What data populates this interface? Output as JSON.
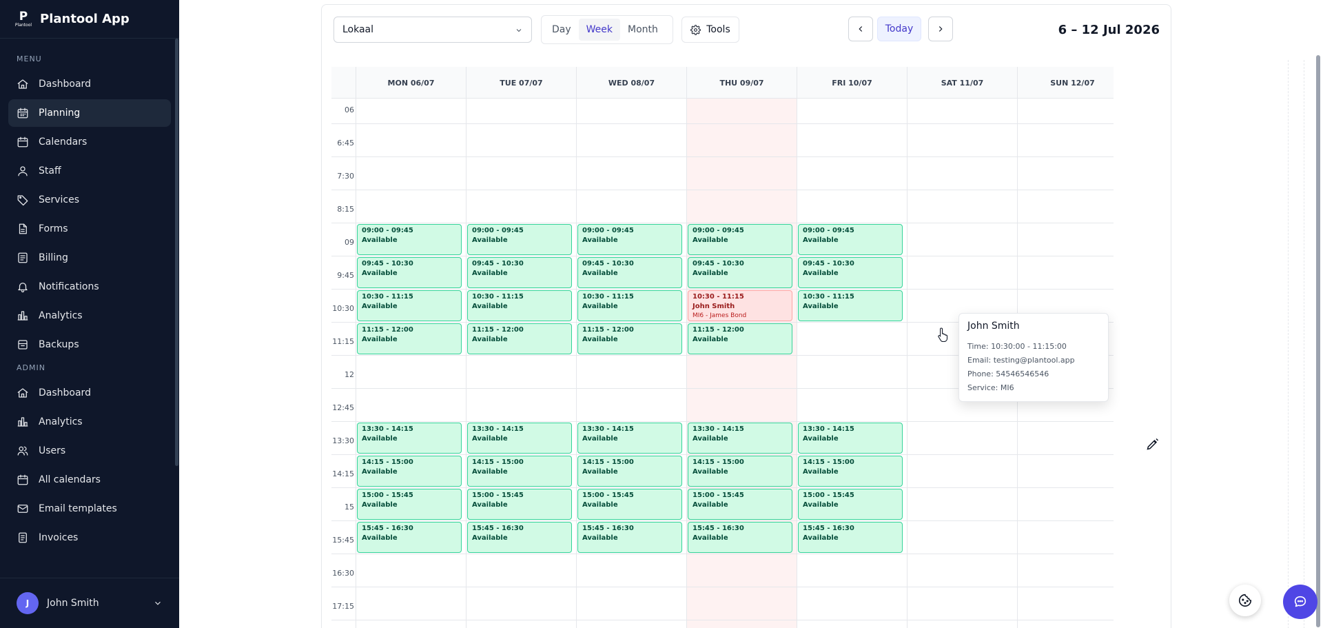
{
  "app": {
    "brand_name": "Plantool App",
    "logo_small": "Plantool",
    "logo_glyph": "P"
  },
  "sidebar": {
    "menu_label": "MENU",
    "menu_items": [
      {
        "label": "Dashboard",
        "icon": "home-icon",
        "active": false
      },
      {
        "label": "Planning",
        "icon": "calendar-grid-icon",
        "active": true
      },
      {
        "label": "Calendars",
        "icon": "calendar-icon",
        "active": false
      },
      {
        "label": "Staff",
        "icon": "user-icon",
        "active": false
      },
      {
        "label": "Services",
        "icon": "tag-icon",
        "active": false
      },
      {
        "label": "Forms",
        "icon": "document-icon",
        "active": false
      },
      {
        "label": "Billing",
        "icon": "credit-card-icon",
        "active": false
      },
      {
        "label": "Notifications",
        "icon": "bell-icon",
        "active": false
      },
      {
        "label": "Analytics",
        "icon": "bar-chart-icon",
        "active": false
      },
      {
        "label": "Backups",
        "icon": "archive-icon",
        "active": false
      }
    ],
    "admin_label": "ADMIN",
    "admin_items": [
      {
        "label": "Dashboard",
        "icon": "home-icon"
      },
      {
        "label": "Analytics",
        "icon": "bar-chart-icon"
      },
      {
        "label": "Users",
        "icon": "users-icon"
      },
      {
        "label": "All calendars",
        "icon": "calendar-icon"
      },
      {
        "label": "Email templates",
        "icon": "mail-icon"
      },
      {
        "label": "Invoices",
        "icon": "receipt-icon"
      }
    ],
    "user": {
      "initial": "J",
      "name": "John Smith"
    }
  },
  "toolbar": {
    "location": "Lokaal",
    "views": [
      {
        "label": "Day",
        "active": false
      },
      {
        "label": "Week",
        "active": true
      },
      {
        "label": "Month",
        "active": false
      }
    ],
    "tools_label": "Tools",
    "today_label": "Today",
    "range_title": "6 – 12 Jul 2026"
  },
  "calendar": {
    "days": [
      "MON 06/07",
      "TUE 07/07",
      "WED 08/07",
      "THU 09/07",
      "FRI 10/07",
      "SAT 11/07",
      "SUN 12/07"
    ],
    "today_index": 3,
    "time_labels": [
      "06",
      "6:45",
      "7:30",
      "8:15",
      "09",
      "9:45",
      "10:30",
      "11:15",
      "12",
      "12:45",
      "13:30",
      "14:15",
      "15",
      "15:45",
      "16:30",
      "17:15"
    ],
    "available_text": "Available",
    "slots": [
      {
        "day": 0,
        "row": 4,
        "time": "09:00 - 09:45",
        "status": "Available"
      },
      {
        "day": 1,
        "row": 4,
        "time": "09:00 - 09:45",
        "status": "Available"
      },
      {
        "day": 2,
        "row": 4,
        "time": "09:00 - 09:45",
        "status": "Available"
      },
      {
        "day": 3,
        "row": 4,
        "time": "09:00 - 09:45",
        "status": "Available"
      },
      {
        "day": 4,
        "row": 4,
        "time": "09:00 - 09:45",
        "status": "Available"
      },
      {
        "day": 0,
        "row": 5,
        "time": "09:45 - 10:30",
        "status": "Available"
      },
      {
        "day": 1,
        "row": 5,
        "time": "09:45 - 10:30",
        "status": "Available"
      },
      {
        "day": 2,
        "row": 5,
        "time": "09:45 - 10:30",
        "status": "Available"
      },
      {
        "day": 3,
        "row": 5,
        "time": "09:45 - 10:30",
        "status": "Available"
      },
      {
        "day": 4,
        "row": 5,
        "time": "09:45 - 10:30",
        "status": "Available"
      },
      {
        "day": 0,
        "row": 6,
        "time": "10:30 - 11:15",
        "status": "Available"
      },
      {
        "day": 1,
        "row": 6,
        "time": "10:30 - 11:15",
        "status": "Available"
      },
      {
        "day": 2,
        "row": 6,
        "time": "10:30 - 11:15",
        "status": "Available"
      },
      {
        "day": 3,
        "row": 6,
        "time": "10:30 - 11:15",
        "status": "John Smith",
        "booked": true,
        "sub": "MI6 - James Bond"
      },
      {
        "day": 4,
        "row": 6,
        "time": "10:30 - 11:15",
        "status": "Available"
      },
      {
        "day": 0,
        "row": 7,
        "time": "11:15 - 12:00",
        "status": "Available"
      },
      {
        "day": 1,
        "row": 7,
        "time": "11:15 - 12:00",
        "status": "Available"
      },
      {
        "day": 2,
        "row": 7,
        "time": "11:15 - 12:00",
        "status": "Available"
      },
      {
        "day": 3,
        "row": 7,
        "time": "11:15 - 12:00",
        "status": "Available"
      },
      {
        "day": 0,
        "row": 10,
        "time": "13:30 - 14:15",
        "status": "Available"
      },
      {
        "day": 1,
        "row": 10,
        "time": "13:30 - 14:15",
        "status": "Available"
      },
      {
        "day": 2,
        "row": 10,
        "time": "13:30 - 14:15",
        "status": "Available"
      },
      {
        "day": 3,
        "row": 10,
        "time": "13:30 - 14:15",
        "status": "Available"
      },
      {
        "day": 4,
        "row": 10,
        "time": "13:30 - 14:15",
        "status": "Available"
      },
      {
        "day": 0,
        "row": 11,
        "time": "14:15 - 15:00",
        "status": "Available"
      },
      {
        "day": 1,
        "row": 11,
        "time": "14:15 - 15:00",
        "status": "Available"
      },
      {
        "day": 2,
        "row": 11,
        "time": "14:15 - 15:00",
        "status": "Available"
      },
      {
        "day": 3,
        "row": 11,
        "time": "14:15 - 15:00",
        "status": "Available"
      },
      {
        "day": 4,
        "row": 11,
        "time": "14:15 - 15:00",
        "status": "Available"
      },
      {
        "day": 0,
        "row": 12,
        "time": "15:00 - 15:45",
        "status": "Available"
      },
      {
        "day": 1,
        "row": 12,
        "time": "15:00 - 15:45",
        "status": "Available"
      },
      {
        "day": 2,
        "row": 12,
        "time": "15:00 - 15:45",
        "status": "Available"
      },
      {
        "day": 3,
        "row": 12,
        "time": "15:00 - 15:45",
        "status": "Available"
      },
      {
        "day": 4,
        "row": 12,
        "time": "15:00 - 15:45",
        "status": "Available"
      },
      {
        "day": 0,
        "row": 13,
        "time": "15:45 - 16:30",
        "status": "Available"
      },
      {
        "day": 1,
        "row": 13,
        "time": "15:45 - 16:30",
        "status": "Available"
      },
      {
        "day": 2,
        "row": 13,
        "time": "15:45 - 16:30",
        "status": "Available"
      },
      {
        "day": 3,
        "row": 13,
        "time": "15:45 - 16:30",
        "status": "Available"
      },
      {
        "day": 4,
        "row": 13,
        "time": "15:45 - 16:30",
        "status": "Available"
      }
    ]
  },
  "tooltip": {
    "name": "John Smith",
    "time": "Time: 10:30:00 - 11:15:00",
    "email": "Email: testing@plantool.app",
    "phone": "Phone: 54546546546",
    "service": "Service: MI6"
  },
  "colors": {
    "sidebar_bg": "#0f172a",
    "available_bg": "#d1fae5",
    "available_border": "#34d399",
    "booked_bg": "#fee2e2",
    "today_col": "#fef2f2",
    "accent": "#4f46e5"
  },
  "fabs": {
    "cookie_icon": "cookie-icon",
    "chat_icon": "chat-icon"
  }
}
